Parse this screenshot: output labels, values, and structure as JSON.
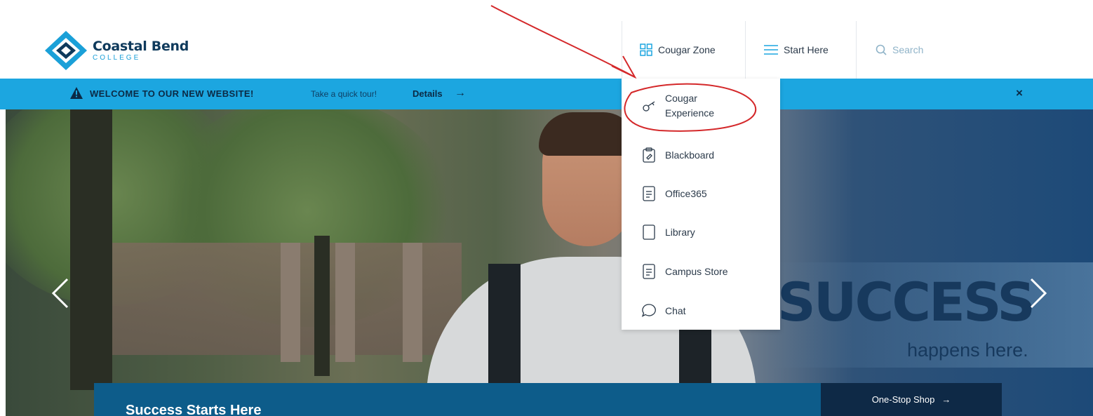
{
  "header": {
    "logo": {
      "name": "Coastal Bend",
      "sub": "COLLEGE"
    },
    "nav": {
      "cougar_zone": "Cougar Zone",
      "start_here": "Start Here",
      "search_placeholder": "Search"
    }
  },
  "banner": {
    "title": "WELCOME TO OUR NEW WEBSITE!",
    "tour": "Take a quick tour!",
    "details": "Details",
    "arrow": "→",
    "close": "×"
  },
  "dropdown": {
    "items": [
      {
        "label_line1": "Cougar",
        "label_line2": "Experience",
        "icon": "key-icon"
      },
      {
        "label": "Blackboard",
        "icon": "clipboard-icon"
      },
      {
        "label": "Office365",
        "icon": "document-icon"
      },
      {
        "label": "Library",
        "icon": "book-icon"
      },
      {
        "label": "Campus Store",
        "icon": "document-icon"
      },
      {
        "label": "Chat",
        "icon": "chat-bubble-icon"
      }
    ]
  },
  "hero": {
    "headline": "SUCCESS",
    "tagline": "happens here.",
    "bottom_title": "Success Starts Here",
    "one_stop": "One-Stop Shop",
    "one_stop_arrow": "→"
  },
  "colors": {
    "banner": "#1ca6e0",
    "navy": "#0e2946",
    "bottom_bar": "#0d5c8a",
    "annotation": "#d4282a"
  }
}
